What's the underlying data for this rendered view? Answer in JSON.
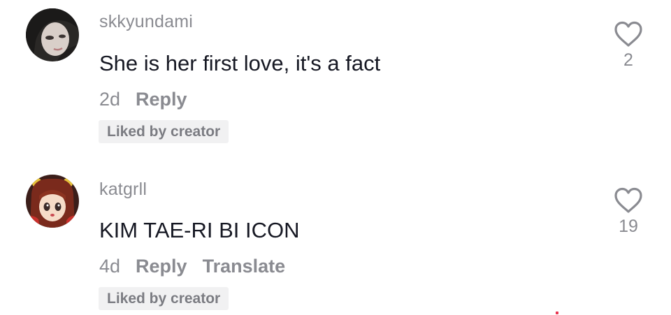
{
  "comments": [
    {
      "username": "skkyundami",
      "text": "She is her first love, it's a fact",
      "time": "2d",
      "reply_label": "Reply",
      "badge": "Liked by creator",
      "likes": "2",
      "avatar_icon": "avatar-photo-dark-hair"
    },
    {
      "username": "katgrll",
      "text": "KIM TAE-RI BI ICON",
      "time": "4d",
      "reply_label": "Reply",
      "translate_label": "Translate",
      "badge": "Liked by creator",
      "likes": "19",
      "avatar_icon": "avatar-anime-character"
    }
  ],
  "colors": {
    "primary_text": "#161823",
    "secondary_text": "#8a8b91",
    "badge_bg": "#f1f1f2"
  }
}
